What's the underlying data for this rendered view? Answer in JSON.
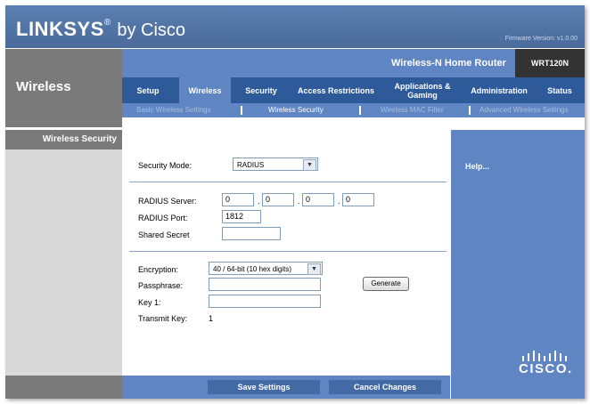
{
  "header": {
    "brand": "LINKSYS",
    "brand_suffix": "by Cisco",
    "registered_mark": "®",
    "firmware": "Firmware Version: v1.0.00"
  },
  "product": {
    "name": "Wireless-N Home Router",
    "model": "WRT120N"
  },
  "section_title": "Wireless",
  "tabs": [
    {
      "label": "Setup"
    },
    {
      "label": "Wireless"
    },
    {
      "label": "Security"
    },
    {
      "label": "Access Restrictions"
    },
    {
      "label": "Applications & Gaming"
    },
    {
      "label": "Administration"
    },
    {
      "label": "Status"
    }
  ],
  "subtabs": [
    {
      "label": "Basic Wireless Settings"
    },
    {
      "label": "Wireless Security"
    },
    {
      "label": "Wireless MAC Filter"
    },
    {
      "label": "Advanced Wireless Settings"
    }
  ],
  "sidebar": {
    "label": "Wireless Security"
  },
  "form": {
    "security_mode_label": "Security Mode:",
    "security_mode_value": "RADIUS",
    "radius_server_label": "RADIUS Server:",
    "radius_server": [
      "0",
      "0",
      "0",
      "0"
    ],
    "radius_port_label": "RADIUS Port:",
    "radius_port": "1812",
    "shared_secret_label": "Shared Secret",
    "shared_secret": "",
    "encryption_label": "Encryption:",
    "encryption_value": "40 / 64-bit (10 hex digits)",
    "passphrase_label": "Passphrase:",
    "passphrase": "",
    "generate_label": "Generate",
    "key1_label": "Key 1:",
    "key1": "",
    "transmit_key_label": "Transmit Key:",
    "transmit_key": "1"
  },
  "help": {
    "label": "Help..."
  },
  "footer": {
    "save_label": "Save Settings",
    "cancel_label": "Cancel Changes"
  },
  "logo_text": "CISCO."
}
